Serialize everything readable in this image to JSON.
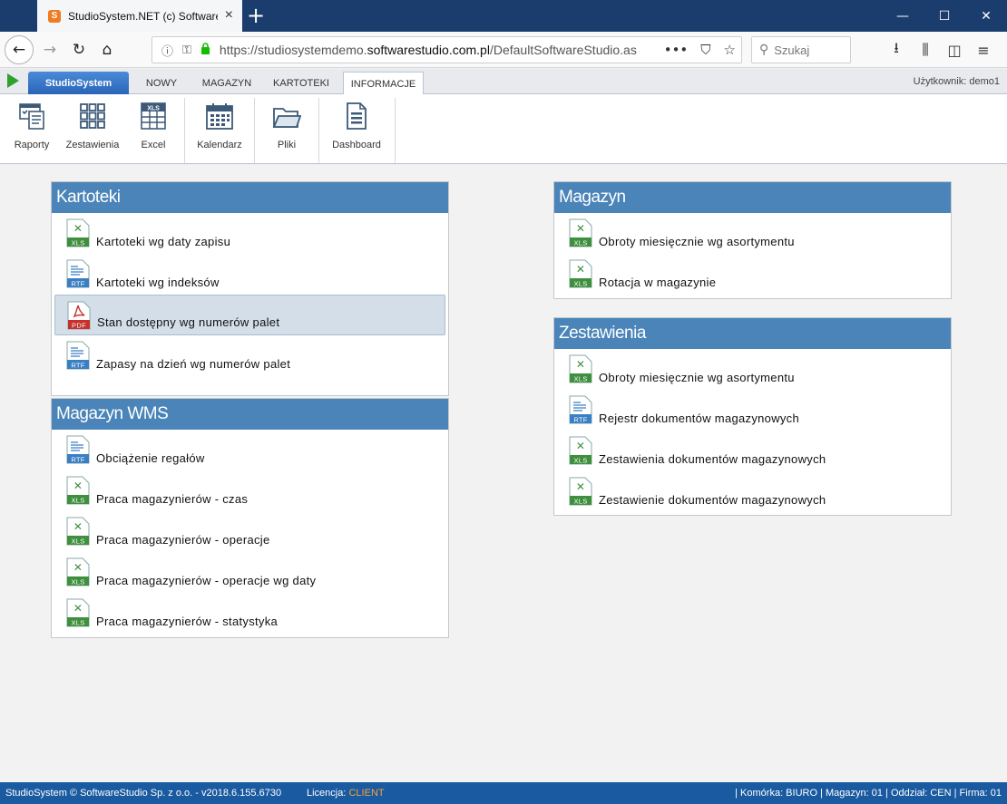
{
  "browser": {
    "tab_title": "StudioSystem.NET (c) Software",
    "favicon_letter": "S",
    "url_prefix": "https://studiosystemdemo.",
    "url_domain": "softwarestudio.com.pl",
    "url_suffix": "/DefaultSoftwareStudio.asp",
    "search_placeholder": "Szukaj",
    "newtab_glyph": "+",
    "close_glyph": "×",
    "minimize_glyph": "—",
    "maximize_glyph": "☐",
    "window_close_glyph": "✕",
    "back_glyph": "←",
    "forward_glyph": "→",
    "reload_glyph": "↻",
    "home_glyph": "⌂",
    "info_glyph": "ⓘ",
    "key_glyph": "⚿",
    "lock_glyph": "🔒",
    "more_glyph": "•••",
    "pocket_glyph": "⛉",
    "star_glyph": "☆",
    "search_glyph": "⚲",
    "download_glyph": "⭳",
    "library_glyph": "⫼",
    "sidebar_glyph": "◫",
    "menu_glyph": "≡"
  },
  "app": {
    "brand_tab": "StudioSystem",
    "tabs": [
      "NOWY",
      "MAGAZYN",
      "KARTOTEKI",
      "INFORMACJE"
    ],
    "active_tab": "INFORMACJE",
    "user_label": "Użytkownik: demo1"
  },
  "ribbon": {
    "buttons": [
      {
        "label": "Raporty",
        "icon": "report-icon"
      },
      {
        "label": "Zestawienia",
        "icon": "grid-icon"
      },
      {
        "label": "Excel",
        "icon": "excel-icon"
      },
      {
        "label": "Kalendarz",
        "icon": "calendar-icon"
      },
      {
        "label": "Pliki",
        "icon": "folder-icon"
      },
      {
        "label": "Dashboard",
        "icon": "dashboard-icon"
      }
    ]
  },
  "panels": {
    "kartoteki": {
      "title": "Kartoteki",
      "items": [
        {
          "label": "Kartoteki wg daty zapisu",
          "type": "XLS"
        },
        {
          "label": "Kartoteki wg indeksów",
          "type": "RTF"
        },
        {
          "label": "Stan dostępny wg numerów palet",
          "type": "PDF"
        },
        {
          "label": "Zapasy na dzień wg numerów palet",
          "type": "RTF"
        }
      ]
    },
    "magazyn_wms": {
      "title": "Magazyn WMS",
      "items": [
        {
          "label": "Obciążenie regałów",
          "type": "RTF"
        },
        {
          "label": "Praca magazynierów - czas",
          "type": "XLS"
        },
        {
          "label": "Praca magazynierów - operacje",
          "type": "XLS"
        },
        {
          "label": "Praca magazynierów - operacje wg daty",
          "type": "XLS"
        },
        {
          "label": "Praca magazynierów - statystyka",
          "type": "XLS"
        }
      ]
    },
    "magazyn": {
      "title": "Magazyn",
      "items": [
        {
          "label": "Obroty miesięcznie wg asortymentu",
          "type": "XLS"
        },
        {
          "label": "Rotacja w magazynie",
          "type": "XLS"
        }
      ]
    },
    "zestawienia": {
      "title": "Zestawienia",
      "items": [
        {
          "label": "Obroty miesięcznie wg asortymentu",
          "type": "XLS"
        },
        {
          "label": "Rejestr dokumentów magazynowych",
          "type": "RTF"
        },
        {
          "label": "Zestawienia dokumentów magazynowych",
          "type": "XLS"
        },
        {
          "label": "Zestawienie dokumentów magazynowych",
          "type": "XLS"
        }
      ]
    }
  },
  "status": {
    "left": "StudioSystem © SoftwareStudio Sp. z o.o. - v2018.6.155.6730",
    "license_label": "Licencja:",
    "license_value": "CLIENT",
    "right": "| Komórka: BIURO | Magazyn: 01 | Oddział: CEN | Firma: 01"
  },
  "colors": {
    "panel_header": "#4a84b8",
    "status_bar": "#1a5aa0",
    "xls": "#3f8f3f",
    "rtf": "#3a7fc4",
    "pdf": "#c8302c"
  }
}
